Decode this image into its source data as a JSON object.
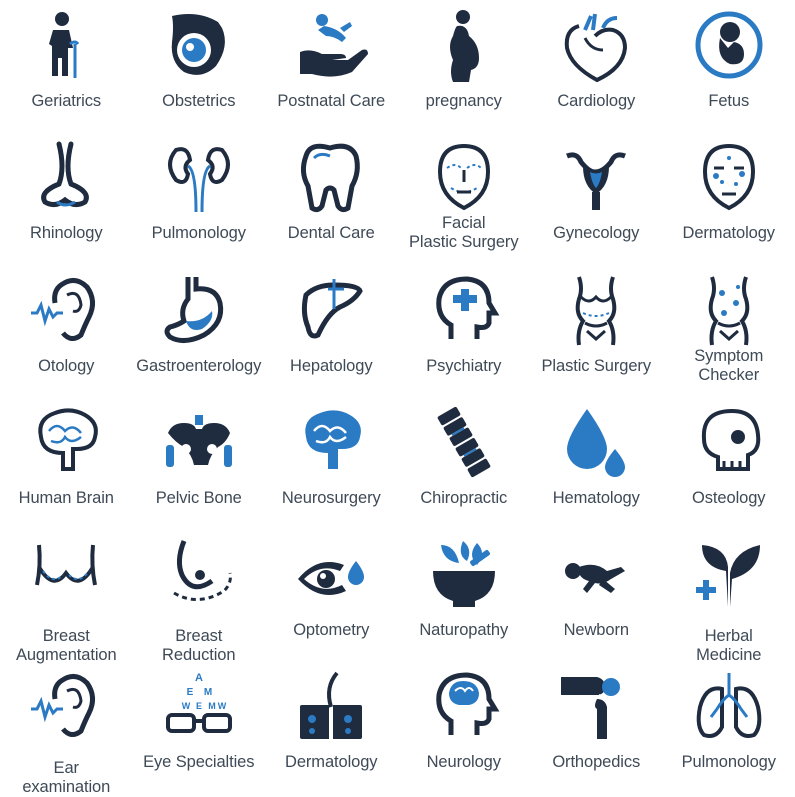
{
  "colors": {
    "dark": "#1f2b3f",
    "blue": "#2b7ac4",
    "label": "#3f4a57"
  },
  "rows": [
    [
      {
        "label": "Geriatrics",
        "icon": "elderly-person-cane-icon"
      },
      {
        "label": "Obstetrics",
        "icon": "pregnant-belly-baby-icon"
      },
      {
        "label": "Postnatal Care",
        "icon": "baby-in-hand-icon"
      },
      {
        "label": "pregnancy",
        "icon": "pregnant-woman-silhouette-icon"
      },
      {
        "label": "Cardiology",
        "icon": "heart-icon"
      },
      {
        "label": "Fetus",
        "icon": "fetus-circle-icon"
      }
    ],
    [
      {
        "label": "Rhinology",
        "icon": "nose-icon"
      },
      {
        "label": "Pulmonology",
        "icon": "kidneys-icon"
      },
      {
        "label": "Dental Care",
        "icon": "tooth-icon"
      },
      {
        "label": "Facial\nPlastic Surgery",
        "icon": "face-marked-icon"
      },
      {
        "label": "Gynecology",
        "icon": "uterus-icon"
      },
      {
        "label": "Dermatology",
        "icon": "face-spots-icon"
      }
    ],
    [
      {
        "label": "Otology",
        "icon": "ear-soundwave-icon"
      },
      {
        "label": "Gastroenterology",
        "icon": "stomach-icon"
      },
      {
        "label": "Hepatology",
        "icon": "liver-icon"
      },
      {
        "label": "Psychiatry",
        "icon": "head-puzzle-icon"
      },
      {
        "label": "Plastic Surgery",
        "icon": "female-torso-icon"
      },
      {
        "label": "Symptom\nChecker",
        "icon": "body-spots-icon"
      }
    ],
    [
      {
        "label": "Human Brain",
        "icon": "brain-outline-icon"
      },
      {
        "label": "Pelvic Bone",
        "icon": "pelvis-icon"
      },
      {
        "label": "Neurosurgery",
        "icon": "brain-filled-icon"
      },
      {
        "label": "Chiropractic",
        "icon": "spine-icon"
      },
      {
        "label": "Hematology",
        "icon": "blood-drops-icon"
      },
      {
        "label": "Osteology",
        "icon": "skull-icon"
      }
    ],
    [
      {
        "label": "Breast\nAugmentation",
        "icon": "breast-icon"
      },
      {
        "label": "Breast\nReduction",
        "icon": "breast-reduction-icon"
      },
      {
        "label": "Optometry",
        "icon": "eye-drop-icon"
      },
      {
        "label": "Naturopathy",
        "icon": "mortar-leaves-icon"
      },
      {
        "label": "Newborn",
        "icon": "newborn-icon"
      },
      {
        "label": "Herbal\nMedicine",
        "icon": "herbal-plant-cross-icon"
      }
    ],
    [
      {
        "label": "Ear\nexamination",
        "icon": "ear-examination-icon"
      },
      {
        "label": "Eye Specialties",
        "icon": "eye-chart-glasses-icon",
        "chart_letters": [
          "A",
          "E",
          "M",
          "W",
          "E",
          "M",
          "W"
        ]
      },
      {
        "label": "Dermatology",
        "icon": "skin-hair-icon"
      },
      {
        "label": "Neurology",
        "icon": "head-brain-icon"
      },
      {
        "label": "Orthopedics",
        "icon": "knee-joint-icon"
      },
      {
        "label": "Pulmonology",
        "icon": "lungs-icon"
      }
    ]
  ]
}
